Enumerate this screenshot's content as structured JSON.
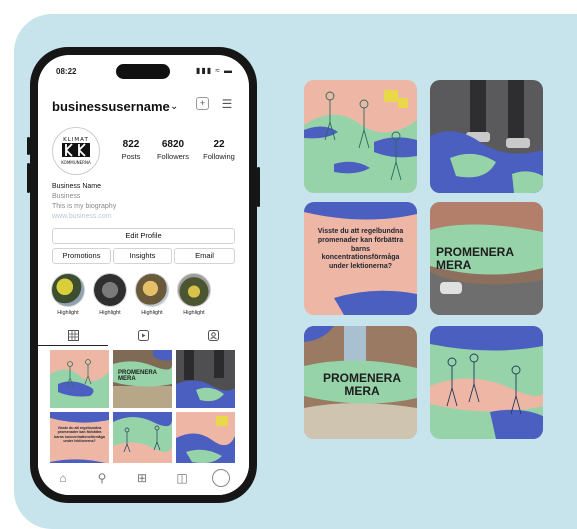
{
  "colors": {
    "panel": "#c7e3ec",
    "peach": "#eeb7a5",
    "mint": "#97d3a9",
    "blue": "#4a5fbf",
    "yellow": "#e9d94a",
    "photo_dark": "#4f4f52"
  },
  "phone": {
    "status_time": "08:22",
    "status_icons": "signal wifi battery",
    "username": "businessusername",
    "stats": [
      {
        "value": "822",
        "label": "Posts"
      },
      {
        "value": "6820",
        "label": "Followers"
      },
      {
        "value": "22",
        "label": "Following"
      }
    ],
    "logo_text": {
      "top": "KLIMAT",
      "bottom": "KOMMUNERNA"
    },
    "bio": {
      "name": "Business Name",
      "category": "Business",
      "text": "This is my biography",
      "link": "www.business.com"
    },
    "buttons": {
      "edit_profile": "Edit Profile",
      "promotions": "Promotions",
      "insights": "Insights",
      "email": "Email"
    },
    "highlights": [
      "Highlight",
      "Highlight",
      "Highlight",
      "Highlight"
    ],
    "tabs": [
      "grid-icon",
      "reels-icon",
      "tagged-icon"
    ],
    "nav": [
      "home-icon",
      "search-icon",
      "add-icon",
      "shop-icon",
      "profile-icon"
    ],
    "grid_texts": {
      "promenera": "PROMENERA MERA",
      "question": "Visste du att regelbundna promenader kan förbättra barns koncentrationsförmåga under lektionerna?"
    }
  },
  "tiles": {
    "question": "Visste du att regelbundna promenader kan förbättra barns koncentrationsförmåga under lektionerna?",
    "promenera_line1": "PROMENERA",
    "promenera_line2": "MERA"
  }
}
